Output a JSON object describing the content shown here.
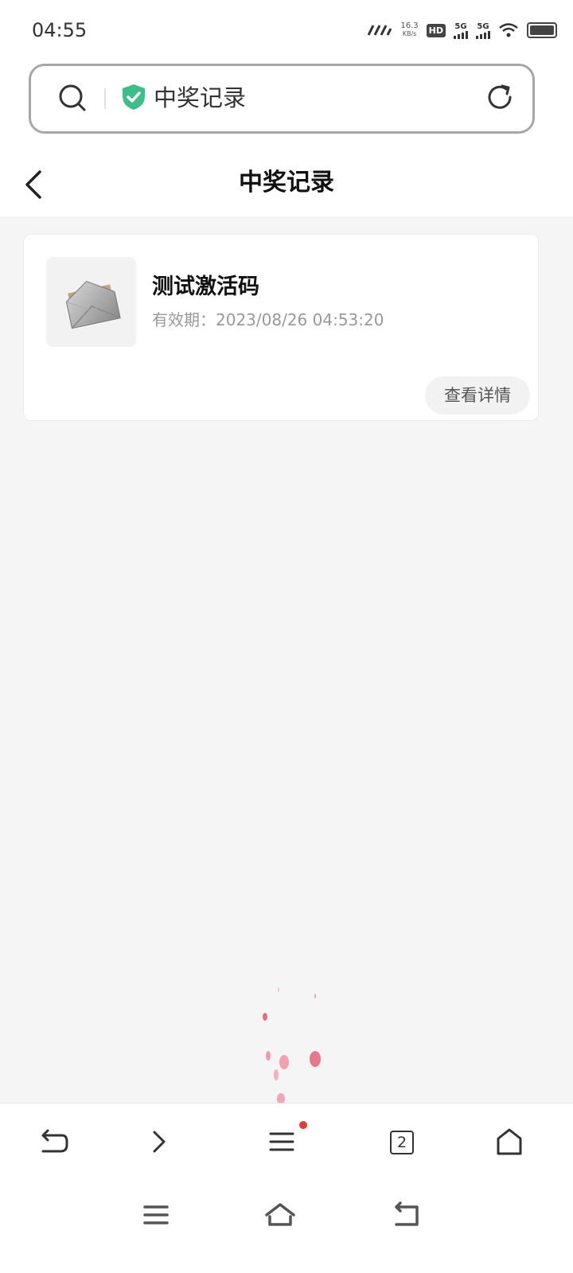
{
  "status": {
    "time": "04:55",
    "net_speed_value": "16.3",
    "net_speed_unit": "KB/s",
    "hd": "HD",
    "sim1": "5G",
    "sim2": "5G"
  },
  "address": {
    "text": "中奖记录"
  },
  "header": {
    "title": "中奖记录"
  },
  "records": [
    {
      "title": "测试激活码",
      "expiry": "有效期：2023/08/26 04:53:20",
      "button": "查看详情"
    }
  ],
  "bottomnav": {
    "tab_count": "2"
  },
  "colors": {
    "accent_shield": "#3dbd8a",
    "badge_dot": "#e53935",
    "background": "#f5f5f5"
  }
}
